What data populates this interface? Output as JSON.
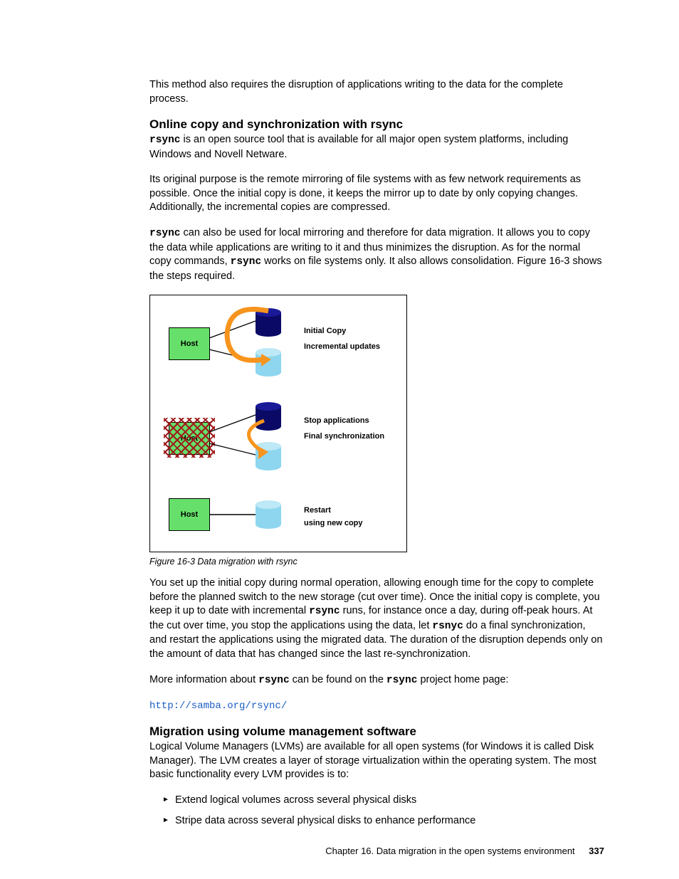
{
  "intro_para": "This method also requires the disruption of applications writing to the data for the complete process.",
  "section1": {
    "heading": "Online copy and synchronization with rsync",
    "p1_a": " is an open source tool that is available for all major open system platforms, including Windows and Novell Netware.",
    "p2": "Its original purpose is the remote mirroring of file systems with as few network requirements as possible. Once the initial copy is done, it keeps the mirror up to date by only copying changes. Additionally, the incremental copies are compressed.",
    "p3_a": " can also be used for local mirroring and therefore for data migration. It allows you to copy the data while applications are writing to it and thus minimizes the disruption. As for the normal copy commands, ",
    "p3_b": " works on file systems only. It also allows consolidation. Figure 16-3 shows the steps required."
  },
  "code": {
    "rsync": "rsync",
    "rsnyc": "rsnyc"
  },
  "figure": {
    "host": "Host",
    "step1a": "Initial Copy",
    "step1b": "Incremental updates",
    "step2a": "Stop applications",
    "step2b": "Final synchronization",
    "step3a": "Restart",
    "step3b": "using new copy",
    "caption": "Figure 16-3   Data migration with rsync"
  },
  "after_fig": {
    "p1_a": "You set up the initial copy during normal operation, allowing enough time for the copy to complete before the planned switch to the new storage (cut over time). Once the initial copy is complete, you keep it up to date with incremental ",
    "p1_b": " runs, for instance once a day, during off-peak hours. At the cut over time, you stop the applications using the data, let ",
    "p1_c": " do a final synchronization, and restart the applications using the migrated data. The duration of the disruption depends only on the amount of data that has changed since the last re-synchronization.",
    "p2_a": "More information about ",
    "p2_b": " can be found on the ",
    "p2_c": " project home page:",
    "link": "http://samba.org/rsync/"
  },
  "section2": {
    "heading": "Migration using volume management software",
    "p1": "Logical Volume Managers (LVMs) are available for all open systems (for Windows it is called Disk Manager). The LVM creates a layer of storage virtualization within the operating system. The most basic functionality every LVM provides is to:",
    "b1": "Extend logical volumes across several physical disks",
    "b2": "Stripe data across several physical disks to enhance performance"
  },
  "footer": {
    "chapter": "Chapter 16. Data migration in the open systems environment",
    "page": "337"
  }
}
